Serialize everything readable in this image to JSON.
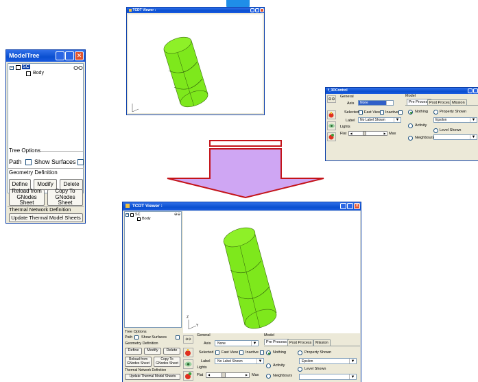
{
  "small_viewer": {
    "title": "TCDT Viewer :"
  },
  "modeltree": {
    "title": "ModelTree",
    "tree": {
      "root": "SC",
      "child": "Body"
    },
    "tree_options_label": "Tree Options",
    "path_label": "Path",
    "show_surfaces_label": "Show Surfaces",
    "geometry_definition_label": "Geometry Definition",
    "define_label": "Define",
    "modify_label": "Modify",
    "delete_label": "Delete",
    "reload_label": "Reload from GNodes Sheet",
    "copy_label": "Copy To GNodes Sheet",
    "thermal_label": "Thermal Network Definition",
    "update_label": "Update Thermal Model Sheets"
  },
  "control": {
    "title": "f_3DControl",
    "general_label": "General",
    "axis_label": "Axis",
    "axis_value": "None",
    "selected_label": "Selected",
    "fast_view_label": "Fast View",
    "inactive_label": "Inactive",
    "label_label": "Label",
    "label_value": "No Label Shown",
    "lights_label": "Lights",
    "flat_label": "Flat",
    "max_label": "Max",
    "model_label": "Model",
    "tabs": [
      "Pre Process",
      "Post Process",
      "Mission"
    ],
    "nothing_label": "Nothing",
    "property_shown_label": "Property Shown",
    "property_value": "Epsilon",
    "activity_label": "Activity",
    "level_shown_label": "Level Shown",
    "neighbours_label": "Neighbours"
  },
  "big_viewer": {
    "title": "TCDT Viewer :",
    "tree": {
      "root": "SC",
      "child": "Body"
    },
    "tree_options_label": "Tree Options",
    "path_label": "Path",
    "show_surfaces_label": "Show Surfaces",
    "geometry_definition_label": "Geometry Definition",
    "define_label": "Define",
    "modify_label": "Modify",
    "delete_label": "Delete",
    "reload_label": "Reload from GNodes Sheet",
    "copy_label": "Copy To GNodes Sheet",
    "thermal_label": "Thermal Network Definition",
    "update_label": "Update Thermal Model Sheets",
    "general_label": "General",
    "axis_label": "Axis",
    "axis_value": "None",
    "selected_label": "Selected",
    "fast_view_label": "Fast View",
    "inactive_label": "Inactive",
    "label_label": "Label",
    "label_value": "No Label Shown",
    "lights_label": "Lights",
    "flat_label": "Flat",
    "max_label": "Max",
    "model_label": "Model",
    "tabs": [
      "Pre Process",
      "Post Process",
      "Mission"
    ],
    "nothing_label": "Nothing",
    "property_shown_label": "Property Shown",
    "property_value": "Epsilon",
    "activity_label": "Activity",
    "level_shown_label": "Level Shown",
    "neighbours_label": "Neighbours",
    "axis_z": "Z",
    "axis_y": "Y"
  },
  "colors": {
    "cylinder": "#7ee81c",
    "arrow_fill": "#cfa6f3",
    "arrow_stroke": "#c4141a",
    "titlebar": "#0a4fd0"
  }
}
